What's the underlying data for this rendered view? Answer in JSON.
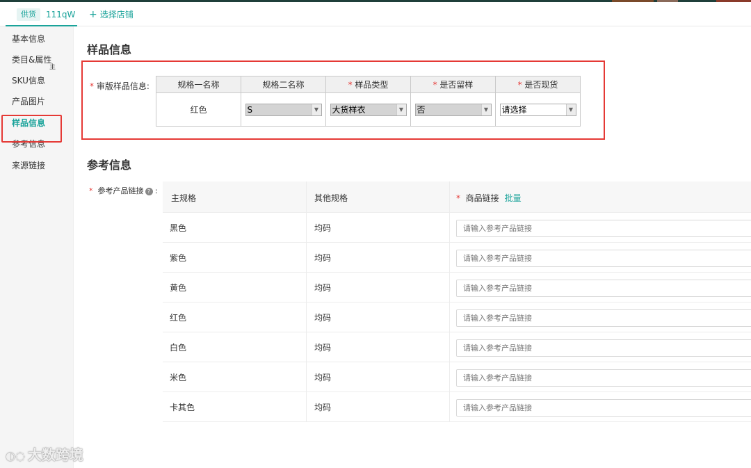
{
  "topbar": {
    "supply_badge": "供货",
    "store_name": "111qW",
    "select_store_label": "选择店铺",
    "colors": {
      "accent": "#1aa39a",
      "stripe": "#1f3f3a"
    }
  },
  "sidebar": {
    "items": [
      {
        "label": "基本信息"
      },
      {
        "label": "类目&属性"
      },
      {
        "label": "SKU信息"
      },
      {
        "label": "产品图片"
      },
      {
        "label": "样品信息"
      },
      {
        "label": "参考信息"
      },
      {
        "label": "来源链接"
      }
    ],
    "sub_glyph": "主",
    "active_index": 4
  },
  "sample_section": {
    "title": "样品信息",
    "field_label": "审版样品信息:",
    "required_mark": "*",
    "columns": [
      "规格一名称",
      "规格二名称",
      "样品类型",
      "是否留样",
      "是否现货"
    ],
    "row": {
      "spec1": "红色",
      "spec2": "S",
      "sample_type": "大货样衣",
      "keep_sample": "否",
      "in_stock": "请选择"
    }
  },
  "reference_section": {
    "title": "参考信息",
    "field_label": "参考产品链接",
    "required_mark": "*",
    "headers": {
      "main_spec": "主规格",
      "other_spec": "其他规格",
      "link": "商品链接",
      "batch": "批量"
    },
    "input_placeholder": "请输入参考产品链接",
    "rows": [
      {
        "main": "黑色",
        "other": "均码"
      },
      {
        "main": "紫色",
        "other": "均码"
      },
      {
        "main": "黄色",
        "other": "均码"
      },
      {
        "main": "红色",
        "other": "均码"
      },
      {
        "main": "白色",
        "other": "均码"
      },
      {
        "main": "米色",
        "other": "均码"
      },
      {
        "main": "卡其色",
        "other": "均码"
      }
    ]
  },
  "watermark": {
    "text": "大数跨境"
  }
}
